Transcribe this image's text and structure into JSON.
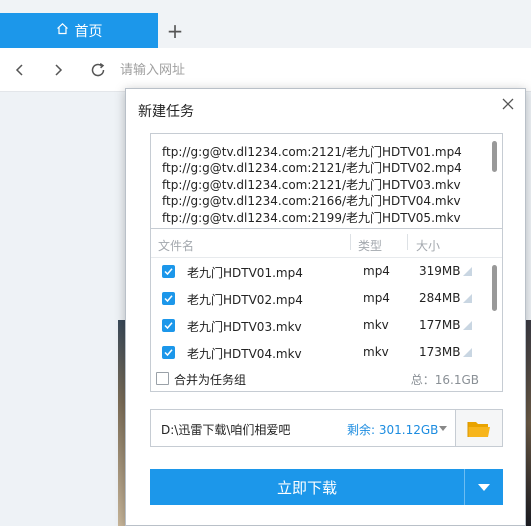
{
  "browser": {
    "tab_label": "首页",
    "new_tab_symbol": "+",
    "address_placeholder": "请输入网址",
    "icons": [
      "home-icon",
      "back-icon",
      "forward-icon",
      "refresh-icon"
    ]
  },
  "dialog": {
    "title": "新建任务",
    "urls": [
      "ftp://g:g@tv.dl1234.com:2121/老九门HDTV01.mp4",
      "ftp://g:g@tv.dl1234.com:2121/老九门HDTV02.mp4",
      "ftp://g:g@tv.dl1234.com:2121/老九门HDTV03.mkv",
      "ftp://g:g@tv.dl1234.com:2166/老九门HDTV04.mkv",
      "ftp://g:g@tv.dl1234.com:2199/老九门HDTV05.mkv"
    ],
    "columns": {
      "name": "文件名",
      "type": "类型",
      "size": "大小"
    },
    "files": [
      {
        "name": "老九门HDTV01.mp4",
        "type": "mp4",
        "size": "319MB",
        "checked": true
      },
      {
        "name": "老九门HDTV02.mp4",
        "type": "mp4",
        "size": "284MB",
        "checked": true
      },
      {
        "name": "老九门HDTV03.mkv",
        "type": "mkv",
        "size": "177MB",
        "checked": true
      },
      {
        "name": "老九门HDTV04.mkv",
        "type": "mkv",
        "size": "173MB",
        "checked": true
      }
    ],
    "merge_label": "合并为任务组",
    "merge_checked": false,
    "total_label": "总：16.1GB",
    "save_path": "D:\\迅雷下载\\咱们相爱吧",
    "free_space": "剩余: 301.12GB",
    "download_label": "立即下载"
  },
  "colors": {
    "accent": "#1c97ea",
    "free_space": "#1c8ce0"
  }
}
